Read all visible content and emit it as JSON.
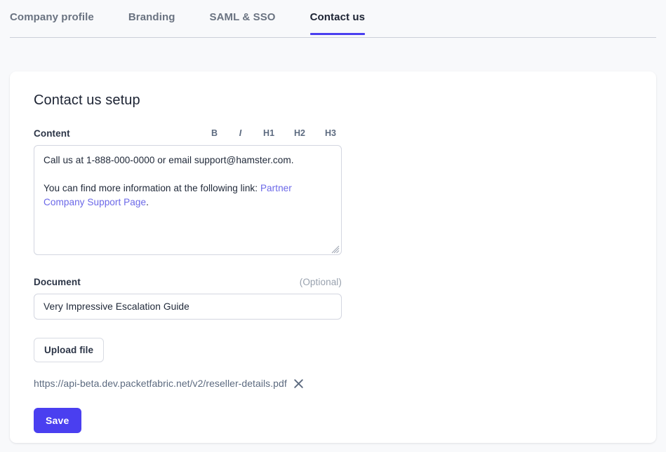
{
  "tabs": [
    {
      "label": "Company profile",
      "active": false
    },
    {
      "label": "Branding",
      "active": false
    },
    {
      "label": "SAML & SSO",
      "active": false
    },
    {
      "label": "Contact us",
      "active": true
    }
  ],
  "card": {
    "title": "Contact us setup",
    "content_field": {
      "label": "Content",
      "toolbar": [
        {
          "name": "bold-button",
          "label": "B"
        },
        {
          "name": "italic-button",
          "label": "I"
        },
        {
          "name": "heading-1-button",
          "label": "H1"
        },
        {
          "name": "heading-2-button",
          "label": "H2"
        },
        {
          "name": "heading-3-button",
          "label": "H3"
        }
      ],
      "paragraph_1": "Call us at 1-888-000-0000 or email support@hamster.com.",
      "paragraph_2_prefix": "You can find more information at the following link: ",
      "paragraph_2_link": "Partner Company Support Page",
      "paragraph_2_suffix": "."
    },
    "document_field": {
      "label": "Document",
      "optional": "(Optional)",
      "value": "Very Impressive Escalation Guide",
      "placeholder": ""
    },
    "upload": {
      "button_label": "Upload file",
      "file_url": "https://api-beta.dev.packetfabric.net/v2/reseller-details.pdf",
      "remove_icon": "close-icon"
    },
    "save_label": "Save"
  },
  "colors": {
    "accent": "#4a3ff0",
    "link": "#6b68e8",
    "page_background": "#f8f9fb",
    "card_background": "#ffffff",
    "border": "#d3d6e0",
    "muted_text": "#6a7381"
  }
}
